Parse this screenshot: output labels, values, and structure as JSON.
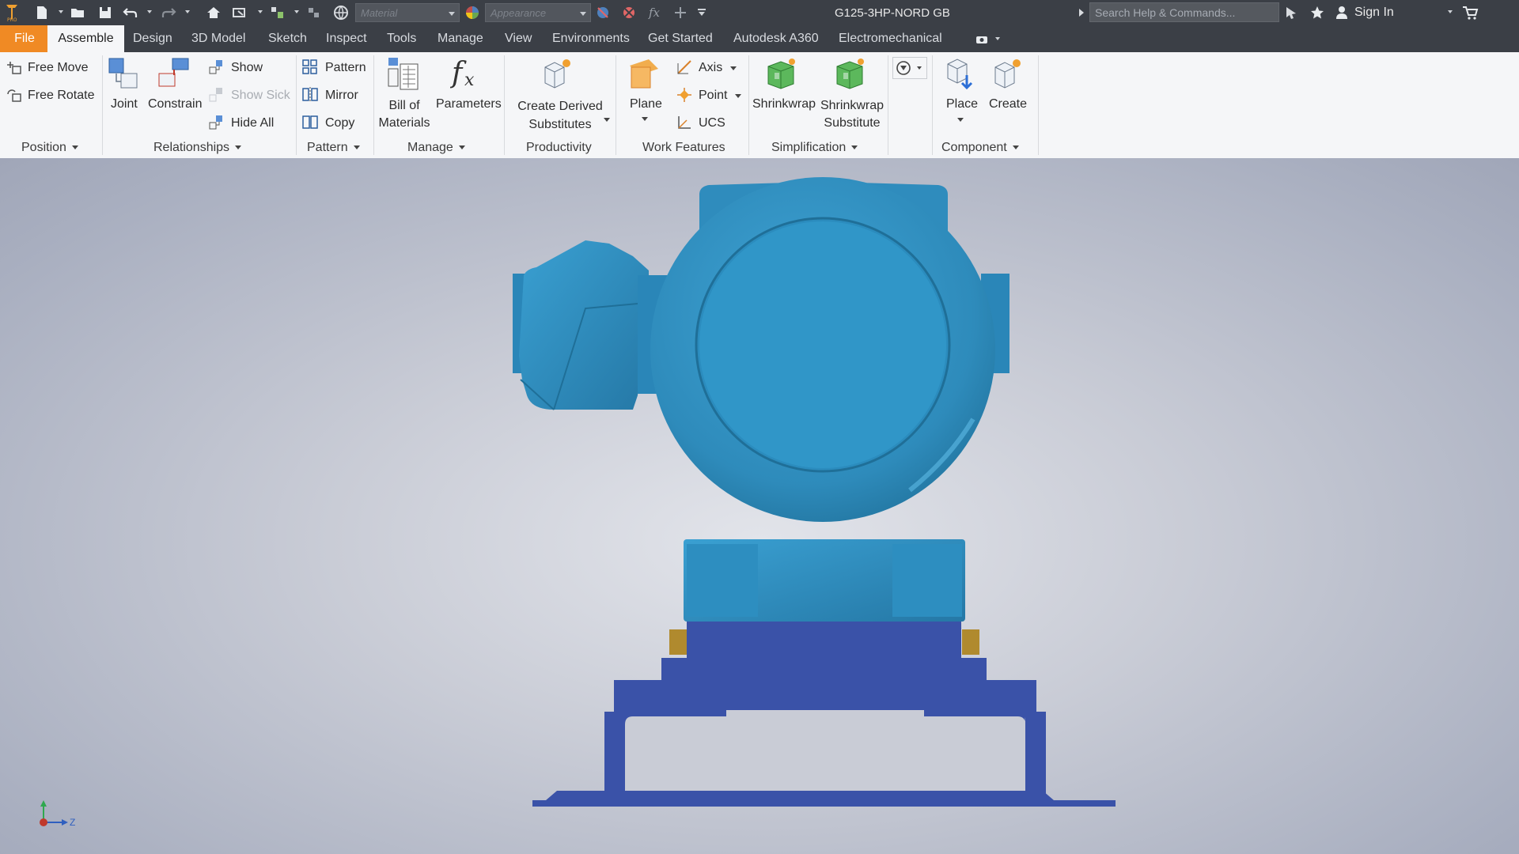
{
  "titlebar": {
    "document_title": "G125-3HP-NORD GB",
    "material_placeholder": "Material",
    "appearance_placeholder": "Appearance",
    "search_placeholder": "Search Help & Commands...",
    "sign_in": "Sign In"
  },
  "tabs": [
    "File",
    "Assemble",
    "Design",
    "3D Model",
    "Sketch",
    "Inspect",
    "Tools",
    "Manage",
    "View",
    "Environments",
    "Get Started",
    "Autodesk A360",
    "Electromechanical"
  ],
  "ribbon": {
    "position": {
      "free_move": "Free Move",
      "free_rotate": "Free Rotate",
      "label": "Position"
    },
    "relationships": {
      "joint": "Joint",
      "constrain": "Constrain",
      "show": "Show",
      "show_sick": "Show Sick",
      "hide_all": "Hide All",
      "label": "Relationships"
    },
    "pattern": {
      "pattern": "Pattern",
      "mirror": "Mirror",
      "copy": "Copy",
      "label": "Pattern"
    },
    "manage": {
      "bom_line1": "Bill of",
      "bom_line2": "Materials",
      "parameters": "Parameters",
      "label": "Manage"
    },
    "productivity": {
      "derived_line1": "Create Derived",
      "derived_line2": "Substitutes",
      "label": "Productivity"
    },
    "work_features": {
      "plane": "Plane",
      "axis": "Axis",
      "point": "Point",
      "ucs": "UCS",
      "label": "Work Features"
    },
    "simplification": {
      "shrinkwrap": "Shrinkwrap",
      "shrinkwrap_sub_line1": "Shrinkwrap",
      "shrinkwrap_sub_line2": "Substitute",
      "label": "Simplification"
    },
    "component": {
      "place": "Place",
      "create": "Create",
      "label": "Component"
    }
  },
  "viewport": {
    "triad_axis_label": "Z"
  },
  "colors": {
    "file_tab": "#f08a24",
    "motor_blue": "#2f8fbf",
    "base_blue": "#3a52a8",
    "mount_gold": "#b08a2e"
  }
}
